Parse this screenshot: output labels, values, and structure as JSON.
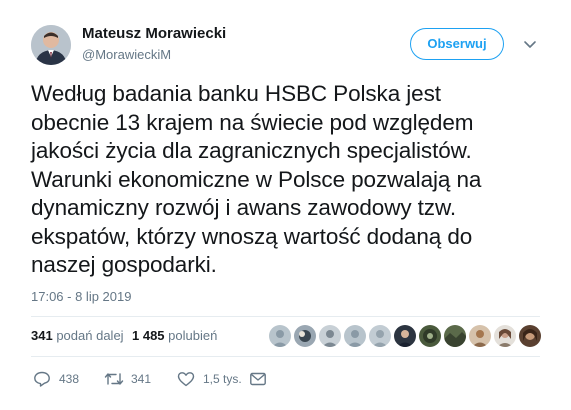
{
  "author": {
    "display_name": "Mateusz Morawiecki",
    "handle": "@MorawieckiM"
  },
  "follow_button": {
    "label": "Obserwuj"
  },
  "tweet": {
    "lines": [
      "Według badania banku HSBC Polska jest",
      "obecnie 13 krajem na świecie pod względem",
      "jakości życia dla zagranicznych specjalistów.",
      "Warunki ekonomiczne w Polsce pozwalają na",
      "dynamiczny rozwój i awans zawodowy tzw.",
      "ekspatów, którzy wnoszą wartość dodaną do",
      "naszej gospodarki."
    ],
    "timestamp": "17:06 - 8 lip 2019"
  },
  "stats": {
    "retweets_count": "341",
    "retweets_label": "podań dalej",
    "likes_count": "1 485",
    "likes_label": "polubień"
  },
  "actions": {
    "reply_count": "438",
    "retweet_count": "341",
    "like_count": "1,5 tys."
  },
  "icons": {
    "reply": "reply-icon",
    "retweet": "retweet-icon",
    "like": "heart-icon",
    "message": "envelope-icon",
    "more": "chevron-down-icon"
  },
  "colors": {
    "accent": "#1da1f2",
    "text": "#14171a",
    "secondary": "#657786",
    "divider": "#e6ecf0"
  }
}
